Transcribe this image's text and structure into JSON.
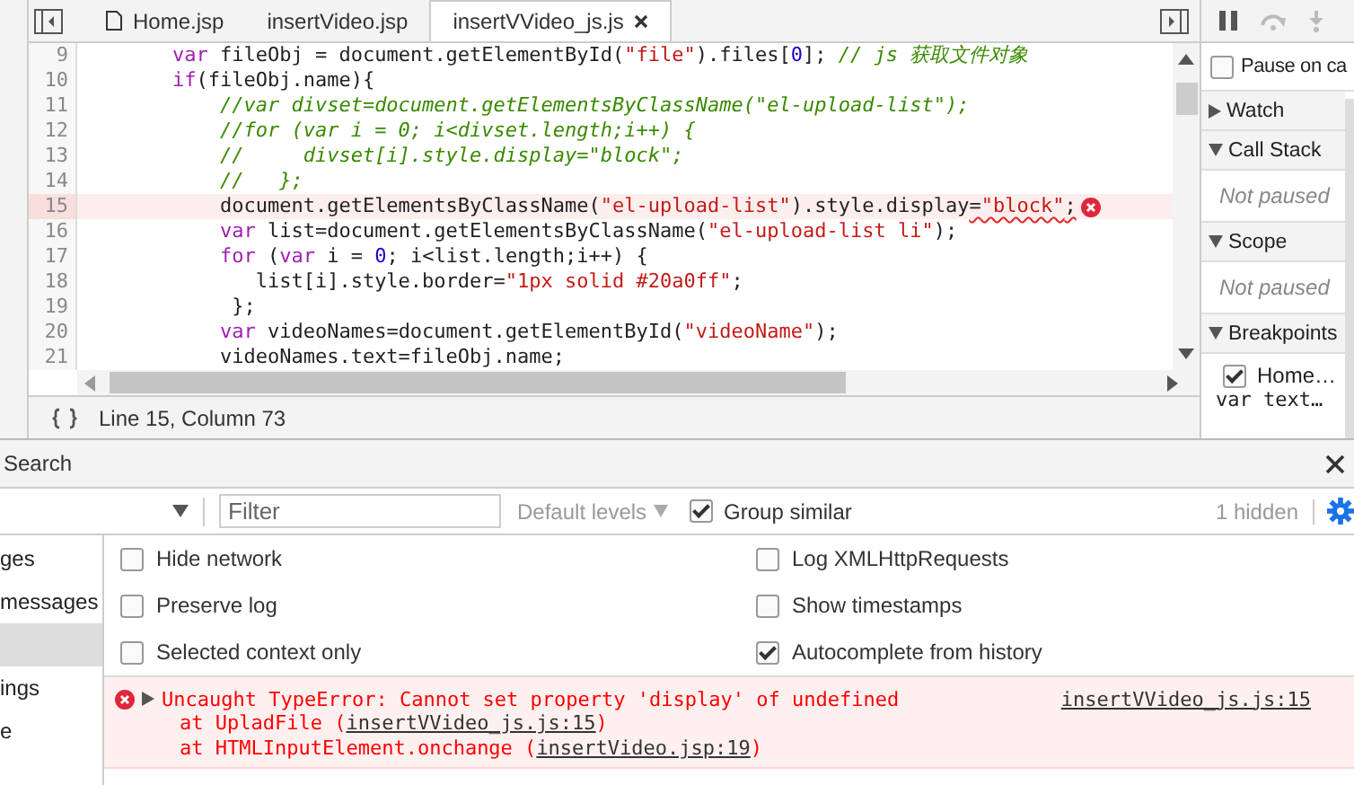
{
  "editor": {
    "tabs": [
      {
        "label": "Home.jsp",
        "selected": false,
        "kind": "file"
      },
      {
        "label": "insertVideo.jsp",
        "selected": false,
        "kind": "plain"
      },
      {
        "label": "insertVVideo_js.js",
        "selected": true,
        "kind": "closable"
      }
    ],
    "lines": [
      {
        "number": "9",
        "error": false,
        "tokens": [
          {
            "kind": "keyword",
            "text": "        var"
          },
          {
            "kind": "plain",
            "text": " fileObj = document.getElementById("
          },
          {
            "kind": "string",
            "text": "\"file\""
          },
          {
            "kind": "plain",
            "text": ").files["
          },
          {
            "kind": "number",
            "text": "0"
          },
          {
            "kind": "plain",
            "text": "]; "
          },
          {
            "kind": "comment",
            "text": "// js 获取文件对象"
          }
        ]
      },
      {
        "number": "10",
        "error": false,
        "tokens": [
          {
            "kind": "keyword",
            "text": "        if"
          },
          {
            "kind": "plain",
            "text": "(fileObj.name){"
          }
        ]
      },
      {
        "number": "11",
        "error": false,
        "tokens": [
          {
            "kind": "comment",
            "text": "            //var divset=document.getElementsByClassName(\"el-upload-list\");"
          }
        ]
      },
      {
        "number": "12",
        "error": false,
        "tokens": [
          {
            "kind": "comment",
            "text": "            //for (var i = 0; i<divset.length;i++) {"
          }
        ]
      },
      {
        "number": "13",
        "error": false,
        "tokens": [
          {
            "kind": "comment",
            "text": "            //     divset[i].style.display=\"block\";"
          }
        ]
      },
      {
        "number": "14",
        "error": false,
        "tokens": [
          {
            "kind": "comment",
            "text": "            //   };"
          }
        ]
      },
      {
        "number": "15",
        "error": true,
        "tokens": [
          {
            "kind": "plain",
            "text": "            document.getElementsByClassName(",
            "squiggly": false
          },
          {
            "kind": "string",
            "text": "\"el-upload-list\"",
            "squiggly": false
          },
          {
            "kind": "plain",
            "text": ").style.display",
            "squiggly": false
          },
          {
            "kind": "plain",
            "text": "=",
            "squiggly": true
          },
          {
            "kind": "string",
            "text": "\"block\"",
            "squiggly": true
          },
          {
            "kind": "plain",
            "text": ";",
            "squiggly": true
          }
        ]
      },
      {
        "number": "16",
        "error": false,
        "tokens": [
          {
            "kind": "keyword",
            "text": "            var"
          },
          {
            "kind": "plain",
            "text": " list=document.getElementsByClassName("
          },
          {
            "kind": "string",
            "text": "\"el-upload-list li\""
          },
          {
            "kind": "plain",
            "text": ");"
          }
        ]
      },
      {
        "number": "17",
        "error": false,
        "tokens": [
          {
            "kind": "keyword",
            "text": "            for"
          },
          {
            "kind": "plain",
            "text": " ("
          },
          {
            "kind": "keyword",
            "text": "var"
          },
          {
            "kind": "plain",
            "text": " i = "
          },
          {
            "kind": "number",
            "text": "0"
          },
          {
            "kind": "plain",
            "text": "; i<list.length;i++) {"
          }
        ]
      },
      {
        "number": "18",
        "error": false,
        "tokens": [
          {
            "kind": "plain",
            "text": "               list[i].style.border="
          },
          {
            "kind": "string",
            "text": "\"1px solid #20a0ff\""
          },
          {
            "kind": "plain",
            "text": ";"
          }
        ]
      },
      {
        "number": "19",
        "error": false,
        "tokens": [
          {
            "kind": "plain",
            "text": "             };"
          }
        ]
      },
      {
        "number": "20",
        "error": false,
        "tokens": [
          {
            "kind": "keyword",
            "text": "            var"
          },
          {
            "kind": "plain",
            "text": " videoNames=document.getElementById("
          },
          {
            "kind": "string",
            "text": "\"videoName\""
          },
          {
            "kind": "plain",
            "text": ");"
          }
        ]
      },
      {
        "number": "21",
        "error": false,
        "tokens": [
          {
            "kind": "plain",
            "text": "            videoNames.text=fileObj.name;"
          }
        ]
      }
    ],
    "status": "Line 15, Column 73"
  },
  "debugger": {
    "pause_on_caught": {
      "label": "Pause on ca",
      "checked": false
    },
    "sections": [
      {
        "title": "Watch",
        "expanded": false
      },
      {
        "title": "Call Stack",
        "expanded": true,
        "note": "Not paused"
      },
      {
        "title": "Scope",
        "expanded": true,
        "note": "Not paused"
      },
      {
        "title": "Breakpoints",
        "expanded": true,
        "breakpoints": [
          {
            "file": "Home…",
            "code": "var text…",
            "checked": true
          }
        ]
      }
    ]
  },
  "drawer": {
    "tab": "Search",
    "toolbar": {
      "filter_placeholder": "Filter",
      "levels": "Default levels",
      "group_similar": {
        "label": "Group similar",
        "checked": true
      },
      "hidden_count": "1 hidden"
    },
    "sidebar": [
      {
        "label": "ges",
        "selected": false
      },
      {
        "label": "messages",
        "selected": false
      },
      {
        "selected": true
      },
      {
        "label": "ings",
        "selected": false
      },
      {
        "label": "e",
        "selected": false
      }
    ],
    "settings": [
      {
        "label": "Hide network",
        "checked": false
      },
      {
        "label": "Log XMLHttpRequests",
        "checked": false
      },
      {
        "label": "Preserve log",
        "checked": false
      },
      {
        "label": "Show timestamps",
        "checked": false
      },
      {
        "label": "Selected context only",
        "checked": false
      },
      {
        "label": "Autocomplete from history",
        "checked": true
      }
    ],
    "error": {
      "message": "Uncaught TypeError: Cannot set property 'display' of undefined",
      "source": "insertVVideo_js.js:15",
      "stack": [
        {
          "text": "at UpladFile (",
          "link": "insertVVideo_js.js:15",
          "close": ")"
        },
        {
          "text": "at HTMLInputElement.onchange (",
          "link": "insertVideo.jsp:19",
          "close": ")"
        }
      ]
    }
  }
}
